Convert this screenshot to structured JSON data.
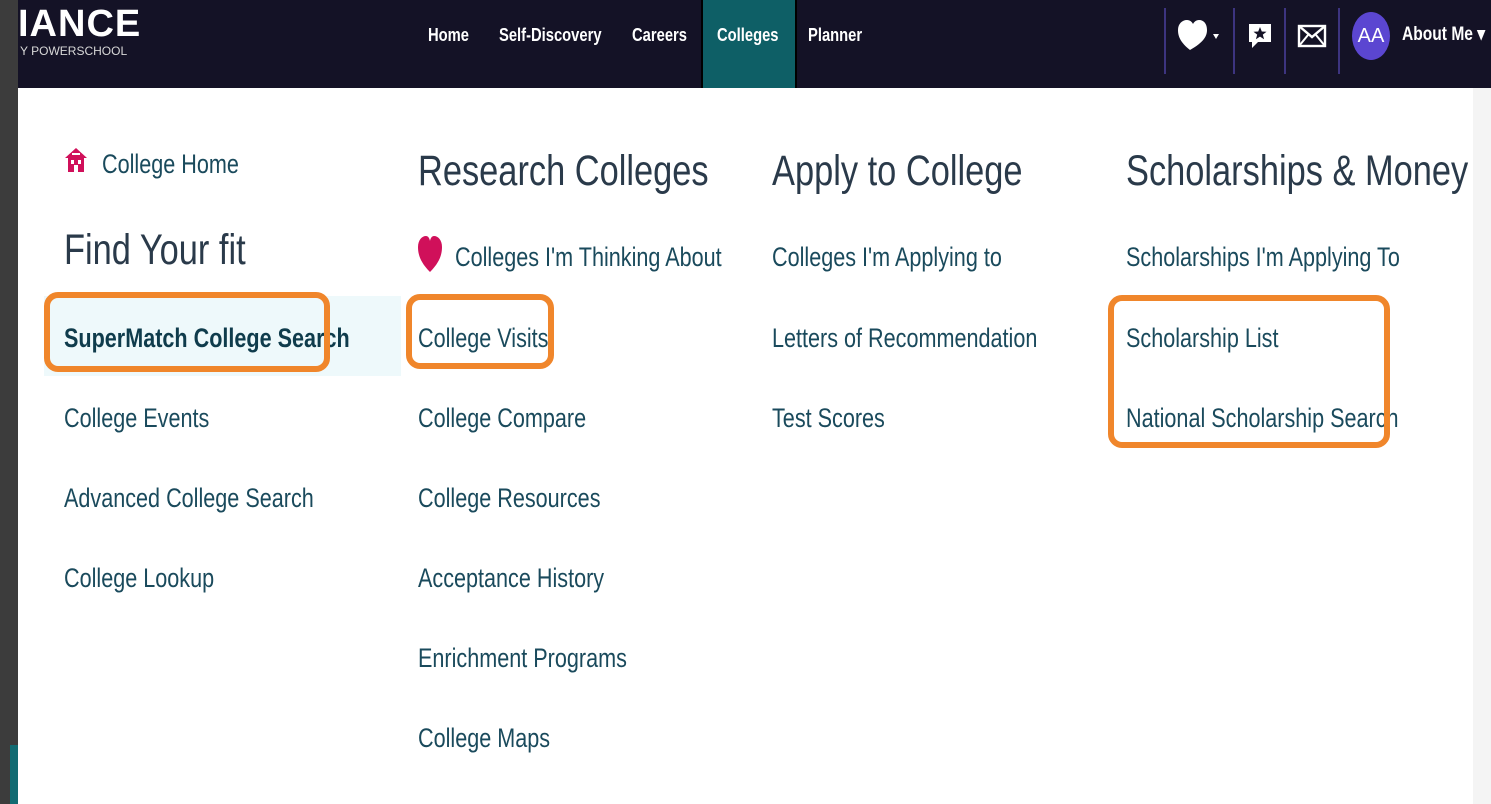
{
  "brand": {
    "name": "IANCE",
    "tagline": "Y POWERSCHOOL"
  },
  "nav": {
    "items": [
      "Home",
      "Self-Discovery",
      "Careers",
      "Colleges",
      "Planner"
    ],
    "active": "Colleges"
  },
  "user": {
    "initials": "AA",
    "about_label": "About Me ▾"
  },
  "icons": {
    "favorites": "heart-icon",
    "notifications": "chat-icon",
    "messages": "mail-icon"
  },
  "colors": {
    "topbar": "#141226",
    "active_nav": "#0e5f66",
    "link": "#1a4a5c",
    "highlight": "#f0862b",
    "avatar": "#5b46d1",
    "heart": "#d0105a"
  },
  "menu": {
    "col1": {
      "home_link": "College Home",
      "heading": "Find Your fit",
      "items": [
        "SuperMatch College Search",
        "College Events",
        "Advanced College Search",
        "College Lookup"
      ]
    },
    "col2": {
      "heading": "Research Colleges",
      "items": [
        "Colleges I'm Thinking About",
        "College Visits",
        "College Compare",
        "College Resources",
        "Acceptance History",
        "Enrichment Programs",
        "College Maps"
      ]
    },
    "col3": {
      "heading": "Apply to College",
      "items": [
        "Colleges I'm Applying to",
        "Letters of Recommendation",
        "Test Scores"
      ]
    },
    "col4": {
      "heading": "Scholarships & Money",
      "items": [
        "Scholarships I'm Applying To",
        "Scholarship List",
        "National Scholarship Search"
      ]
    }
  }
}
